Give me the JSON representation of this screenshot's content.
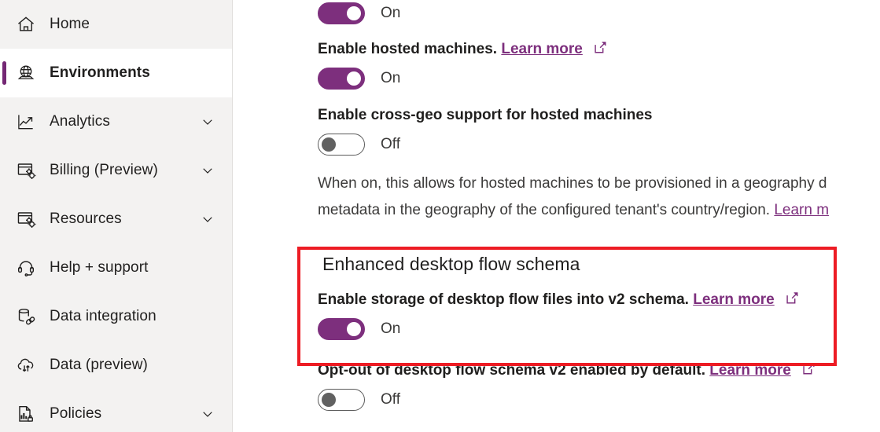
{
  "sidebar": {
    "items": [
      {
        "label": "Home",
        "icon": "home-icon",
        "selected": false,
        "expandable": false
      },
      {
        "label": "Environments",
        "icon": "globe-icon",
        "selected": true,
        "expandable": false
      },
      {
        "label": "Analytics",
        "icon": "line-chart-icon",
        "selected": false,
        "expandable": true
      },
      {
        "label": "Billing (Preview)",
        "icon": "window-gears-icon",
        "selected": false,
        "expandable": true
      },
      {
        "label": "Resources",
        "icon": "window-gears-icon",
        "selected": false,
        "expandable": true
      },
      {
        "label": "Help + support",
        "icon": "headset-icon",
        "selected": false,
        "expandable": false
      },
      {
        "label": "Data integration",
        "icon": "database-link-icon",
        "selected": false,
        "expandable": false
      },
      {
        "label": "Data (preview)",
        "icon": "cloud-sync-icon",
        "selected": false,
        "expandable": false
      },
      {
        "label": "Policies",
        "icon": "document-lock-icon",
        "selected": false,
        "expandable": true
      }
    ]
  },
  "main": {
    "settings": [
      {
        "id": "partial-top-toggle",
        "label": null,
        "state_label": "On",
        "state": "on"
      },
      {
        "id": "enable-hosted-machines",
        "label": "Enable hosted machines.",
        "link_label": "Learn more",
        "state_label": "On",
        "state": "on"
      },
      {
        "id": "enable-cross-geo-support",
        "label": "Enable cross-geo support for hosted machines",
        "state_label": "Off",
        "state": "off"
      }
    ],
    "cross_geo_description_line1": "When on, this allows for hosted machines to be provisioned in a geography d",
    "cross_geo_description_line2": "metadata in the geography of the configured tenant's country/region. ",
    "cross_geo_description_link": "Learn m",
    "highlighted_section": {
      "title": "Enhanced desktop flow schema",
      "setting_label": "Enable storage of desktop flow files into v2 schema.",
      "link_label": "Learn more",
      "state_label": "On",
      "state": "on"
    },
    "optout_setting": {
      "label": "Opt-out of desktop flow schema v2 enabled by default.",
      "link_label": "Learn more",
      "state_label": "Off",
      "state": "off"
    }
  },
  "colors": {
    "accent_purple": "#7d2f7d",
    "highlight_red": "#ed1c24",
    "sidebar_bg": "#f3f2f1",
    "text": "#201f1e"
  }
}
